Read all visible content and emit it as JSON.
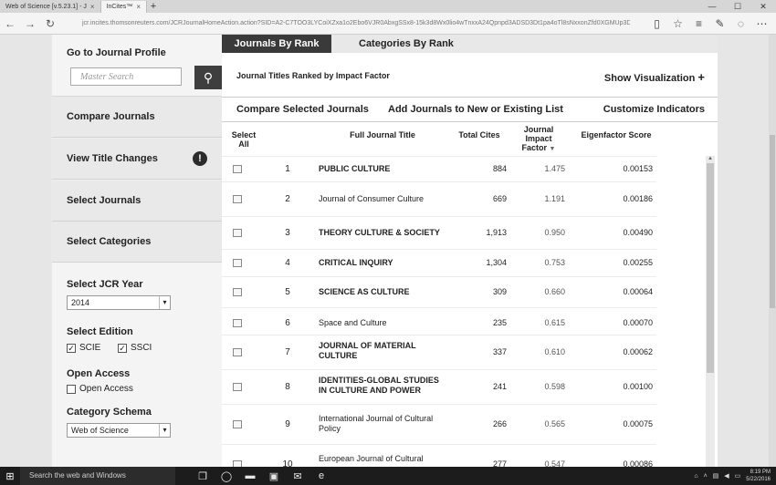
{
  "browser": {
    "tabs": [
      {
        "label": "Web of Science [v.5.23.1] - J",
        "active": false
      },
      {
        "label": "InCites™",
        "active": true
      }
    ],
    "url": "jcr.incites.thomsonreuters.com/JCRJournalHomeAction.action?SID=A2-C7TOO3LYCoiXZxa1o2Ebo6VJR0AbxgSSx8-15k3d8Wx0lio4wTnxxA24Qpnpd3ADSD3Dt1pa4oTl8sNxxonZfd0XGMUp3Dx3D-Ve5a0Ww2Sx2Bf_2BSpx"
  },
  "sidebar": {
    "profile_title": "Go to Journal Profile",
    "search_placeholder": "Master Search",
    "items": [
      {
        "label": "Compare Journals"
      },
      {
        "label": "View Title Changes",
        "alert": "!"
      },
      {
        "label": "Select Journals"
      },
      {
        "label": "Select Categories"
      }
    ],
    "jcr_year_label": "Select JCR Year",
    "jcr_year_value": "2014",
    "edition_label": "Select Edition",
    "editions": [
      {
        "label": "SCIE",
        "checked": true
      },
      {
        "label": "SSCI",
        "checked": true
      }
    ],
    "open_access_label": "Open Access",
    "open_access_option": "Open Access",
    "scheme_label": "Category Schema",
    "scheme_value": "Web of Science"
  },
  "main": {
    "tabs": [
      "Journals By Rank",
      "Categories By Rank"
    ],
    "heading": "Journal Titles Ranked by Impact Factor",
    "show_visualization": "Show Visualization",
    "toolbar": {
      "compare": "Compare Selected Journals",
      "add": "Add Journals to New or Existing List",
      "customize": "Customize Indicators"
    },
    "columns": {
      "select": "Select All",
      "title": "Full Journal Title",
      "cites": "Total Cites",
      "jif": "Journal Impact Factor",
      "eigen": "Eigenfactor Score"
    },
    "rows": [
      {
        "rank": "1",
        "title": "PUBLIC CULTURE",
        "caps": true,
        "cites": "884",
        "jif": "1.475",
        "eigen": "0.00153"
      },
      {
        "rank": "2",
        "title": "Journal of Consumer Culture",
        "caps": false,
        "cites": "669",
        "jif": "1.191",
        "eigen": "0.00186"
      },
      {
        "rank": "3",
        "title": "THEORY CULTURE & SOCIETY",
        "caps": true,
        "cites": "1,913",
        "jif": "0.950",
        "eigen": "0.00490"
      },
      {
        "rank": "4",
        "title": "CRITICAL INQUIRY",
        "caps": true,
        "cites": "1,304",
        "jif": "0.753",
        "eigen": "0.00255"
      },
      {
        "rank": "5",
        "title": "SCIENCE AS CULTURE",
        "caps": true,
        "cites": "309",
        "jif": "0.660",
        "eigen": "0.00064"
      },
      {
        "rank": "6",
        "title": "Space and Culture",
        "caps": false,
        "cites": "235",
        "jif": "0.615",
        "eigen": "0.00070"
      },
      {
        "rank": "7",
        "title": "JOURNAL OF MATERIAL CULTURE",
        "caps": true,
        "cites": "337",
        "jif": "0.610",
        "eigen": "0.00062"
      },
      {
        "rank": "8",
        "title": "IDENTITIES-GLOBAL STUDIES IN CULTURE AND POWER",
        "caps": true,
        "cites": "241",
        "jif": "0.598",
        "eigen": "0.00100"
      },
      {
        "rank": "9",
        "title": "International Journal of Cultural Policy",
        "caps": false,
        "cites": "266",
        "jif": "0.565",
        "eigen": "0.00075"
      },
      {
        "rank": "10",
        "title": "European Journal of Cultural",
        "caps": false,
        "cites": "277",
        "jif": "0.547",
        "eigen": "0.00086"
      }
    ]
  },
  "taskbar": {
    "search": "Search the web and Windows",
    "time": "8:19 PM",
    "date": "5/22/2016"
  }
}
